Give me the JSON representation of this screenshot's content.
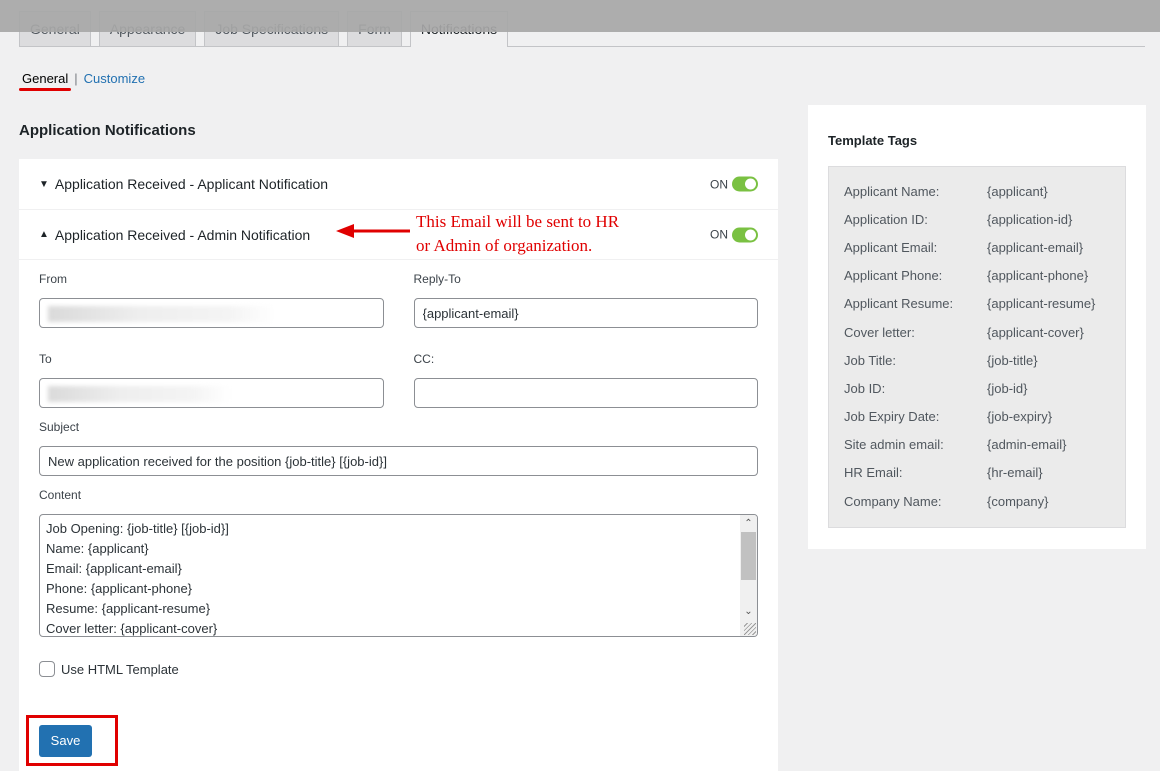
{
  "tabs": [
    {
      "label": "General",
      "active": false
    },
    {
      "label": "Appearance",
      "active": false
    },
    {
      "label": "Job Specifications",
      "active": false
    },
    {
      "label": "Form",
      "active": false
    },
    {
      "label": "Notifications",
      "active": true
    }
  ],
  "subnav": {
    "current": "General",
    "separator": "|",
    "link": "Customize"
  },
  "section_title": "Application Notifications",
  "panels": [
    {
      "title": "Application Received - Applicant Notification",
      "state": "collapsed",
      "toggle_label": "ON",
      "toggle_on": true
    },
    {
      "title": "Application Received - Admin Notification",
      "state": "expanded",
      "toggle_label": "ON",
      "toggle_on": true
    }
  ],
  "annotation": {
    "line1": "This Email will be sent to HR",
    "line2": "or Admin of organization.",
    "color": "#e00000"
  },
  "form": {
    "from_label": "From",
    "from_value": "[redacted]",
    "reply_to_label": "Reply-To",
    "reply_to_value": "{applicant-email}",
    "to_label": "To",
    "to_value": "[redacted]",
    "cc_label": "CC:",
    "cc_value": "",
    "subject_label": "Subject",
    "subject_value": "New application received for the position {job-title} [{job-id}]",
    "content_label": "Content",
    "content_lines": [
      "Job Opening: {job-title} [{job-id}]",
      "Name: {applicant}",
      "Email: {applicant-email}",
      "Phone: {applicant-phone}",
      "Resume: {applicant-resume}",
      "Cover letter: {applicant-cover}"
    ],
    "html_template_label": "Use HTML Template",
    "html_template_checked": false,
    "save_label": "Save"
  },
  "sidebar": {
    "title": "Template Tags",
    "tags": [
      {
        "name": "Applicant Name:",
        "tag": "{applicant}"
      },
      {
        "name": "Application ID:",
        "tag": "{application-id}"
      },
      {
        "name": "Applicant Email:",
        "tag": "{applicant-email}"
      },
      {
        "name": "Applicant Phone:",
        "tag": "{applicant-phone}"
      },
      {
        "name": "Applicant Resume:",
        "tag": "{applicant-resume}"
      },
      {
        "name": "Cover letter:",
        "tag": "{applicant-cover}"
      },
      {
        "name": "Job Title:",
        "tag": "{job-title}"
      },
      {
        "name": "Job ID:",
        "tag": "{job-id}"
      },
      {
        "name": "Job Expiry Date:",
        "tag": "{job-expiry}"
      },
      {
        "name": "Site admin email:",
        "tag": "{admin-email}"
      },
      {
        "name": "HR Email:",
        "tag": "{hr-email}"
      },
      {
        "name": "Company Name:",
        "tag": "{company}"
      }
    ]
  },
  "colors": {
    "accent": "#2271b1",
    "toggle_on": "#7ac142",
    "highlight": "#e00000"
  }
}
